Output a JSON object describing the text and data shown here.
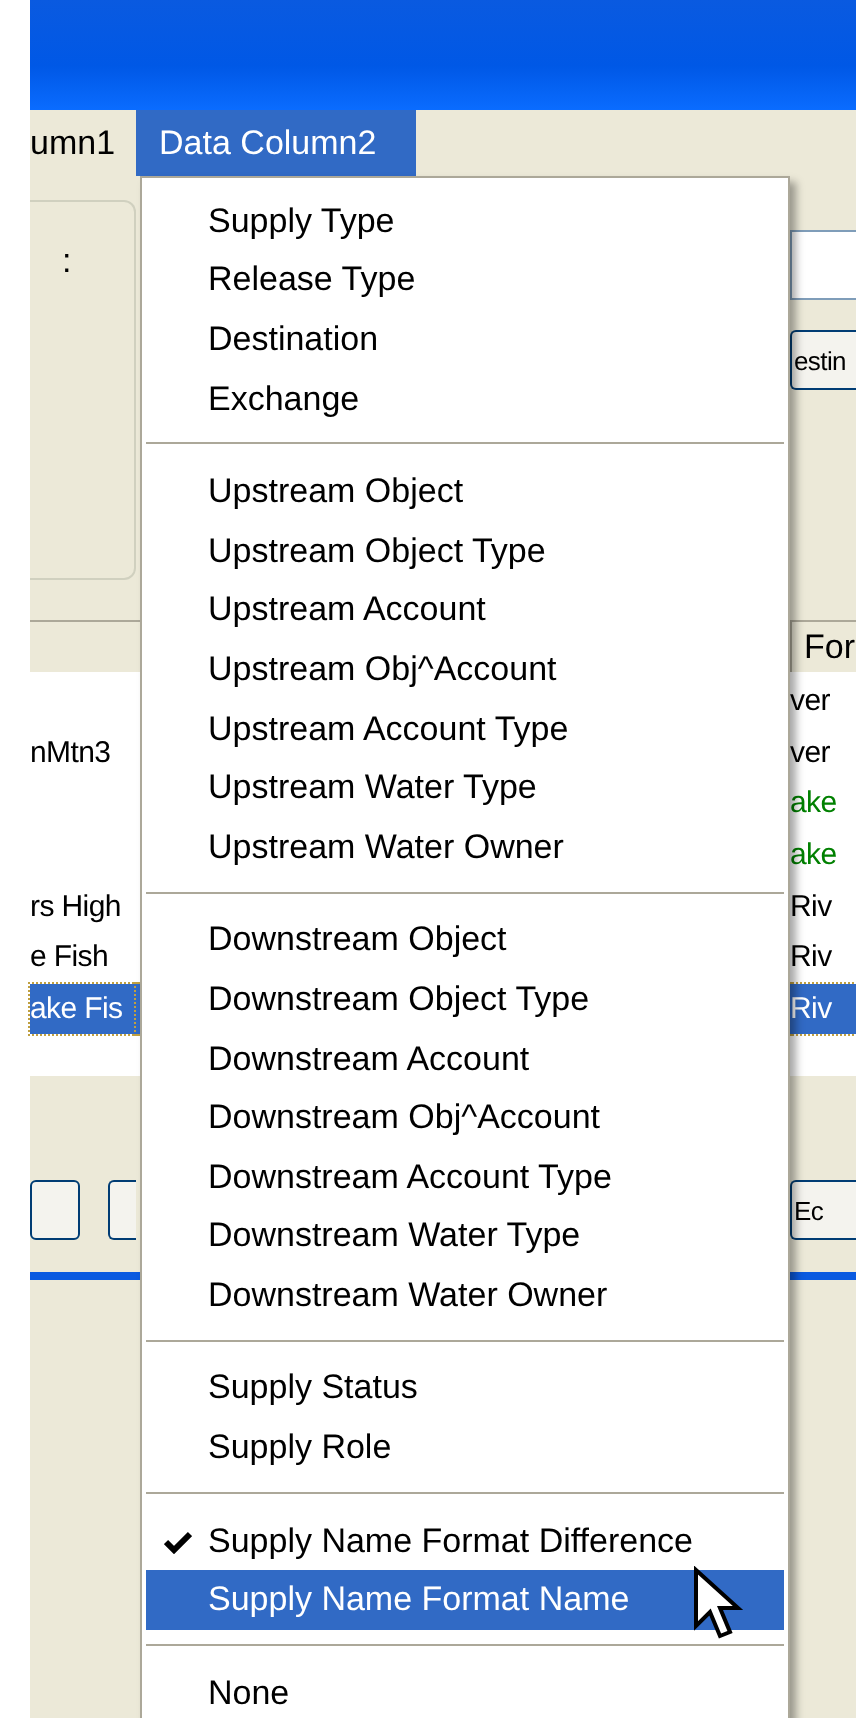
{
  "menu_bar": [
    {
      "label": "umn1",
      "selected": false
    },
    {
      "label": "Data Column2",
      "selected": true
    }
  ],
  "background": {
    "group_label": ":",
    "right_button": "estin",
    "header": "For",
    "rows": [
      {
        "left": "",
        "right": "ver",
        "color": "#000000",
        "selected": false
      },
      {
        "left": "nMtn3",
        "right": "ver",
        "color": "#000000",
        "selected": false
      },
      {
        "left": "",
        "right": "ake",
        "color": "#008000",
        "selected": false
      },
      {
        "left": "",
        "right": "ake",
        "color": "#008000",
        "selected": false
      },
      {
        "left": "rs High",
        "right": "Riv",
        "color": "#000000",
        "selected": false
      },
      {
        "left": "e Fish",
        "right": "Riv",
        "color": "#000000",
        "selected": false
      },
      {
        "left": "ake Fis",
        "right": "Riv",
        "selected": true
      }
    ],
    "bottom_button": "Ec"
  },
  "menu": {
    "groups": [
      [
        {
          "label": "Supply Type",
          "checked": false,
          "selected": false
        },
        {
          "label": "Release Type",
          "checked": false,
          "selected": false
        },
        {
          "label": "Destination",
          "checked": false,
          "selected": false
        },
        {
          "label": "Exchange",
          "checked": false,
          "selected": false
        }
      ],
      [
        {
          "label": "Upstream Object",
          "checked": false,
          "selected": false
        },
        {
          "label": "Upstream Object Type",
          "checked": false,
          "selected": false
        },
        {
          "label": "Upstream Account",
          "checked": false,
          "selected": false
        },
        {
          "label": "Upstream Obj^Account",
          "checked": false,
          "selected": false
        },
        {
          "label": "Upstream Account Type",
          "checked": false,
          "selected": false
        },
        {
          "label": "Upstream Water Type",
          "checked": false,
          "selected": false
        },
        {
          "label": "Upstream Water Owner",
          "checked": false,
          "selected": false
        }
      ],
      [
        {
          "label": "Downstream Object",
          "checked": false,
          "selected": false
        },
        {
          "label": "Downstream Object Type",
          "checked": false,
          "selected": false
        },
        {
          "label": "Downstream Account",
          "checked": false,
          "selected": false
        },
        {
          "label": "Downstream Obj^Account",
          "checked": false,
          "selected": false
        },
        {
          "label": "Downstream Account Type",
          "checked": false,
          "selected": false
        },
        {
          "label": "Downstream Water Type",
          "checked": false,
          "selected": false
        },
        {
          "label": "Downstream Water Owner",
          "checked": false,
          "selected": false
        }
      ],
      [
        {
          "label": "Supply Status",
          "checked": false,
          "selected": false
        },
        {
          "label": "Supply Role",
          "checked": false,
          "selected": false
        }
      ],
      [
        {
          "label": "Supply Name Format Difference",
          "checked": true,
          "selected": false
        },
        {
          "label": "Supply Name Format Name",
          "checked": false,
          "selected": true
        }
      ],
      [
        {
          "label": "None",
          "checked": false,
          "selected": false
        }
      ]
    ]
  }
}
